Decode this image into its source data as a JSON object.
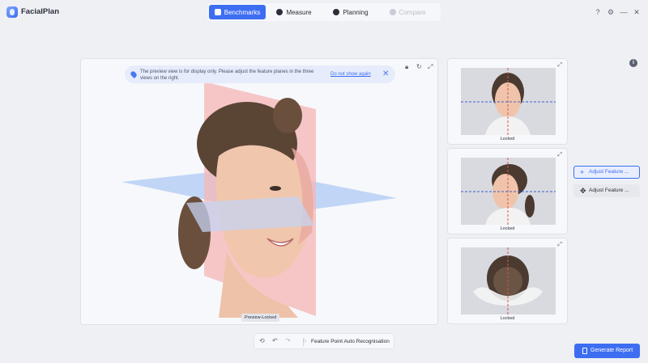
{
  "app": {
    "name": "FacialPlan"
  },
  "tabs": [
    {
      "label": "Benchmarks",
      "icon": "tooth-icon",
      "state": "active"
    },
    {
      "label": "Measure",
      "icon": "head-icon",
      "state": "normal"
    },
    {
      "label": "Planning",
      "icon": "profile-icon",
      "state": "normal"
    },
    {
      "label": "Compare",
      "icon": "compare-icon",
      "state": "disabled"
    }
  ],
  "window": {
    "help": "?",
    "settings": "⚙",
    "minimize": "—",
    "close": "✕"
  },
  "notice": {
    "message": "The preview view is for display only. Please adjust the feature planes in the three views on the right.",
    "link": "Do not show again",
    "close": "✕"
  },
  "main_view": {
    "badge": "Preview-Locked"
  },
  "side_views": [
    {
      "caption": "Locked"
    },
    {
      "caption": "Locked"
    },
    {
      "caption": "Locked"
    }
  ],
  "adjust": {
    "primary": "Adjust Feature ...",
    "secondary": "Adjust Feature ..."
  },
  "toolbar": {
    "feature_label": "Feature Point Auto Recognisation"
  },
  "report": {
    "label": "Generate Report"
  },
  "colors": {
    "accent": "#3d6ef2",
    "background": "#eef0f4",
    "plane_red": "#f4a7a7",
    "plane_blue": "#a9c8f5"
  }
}
